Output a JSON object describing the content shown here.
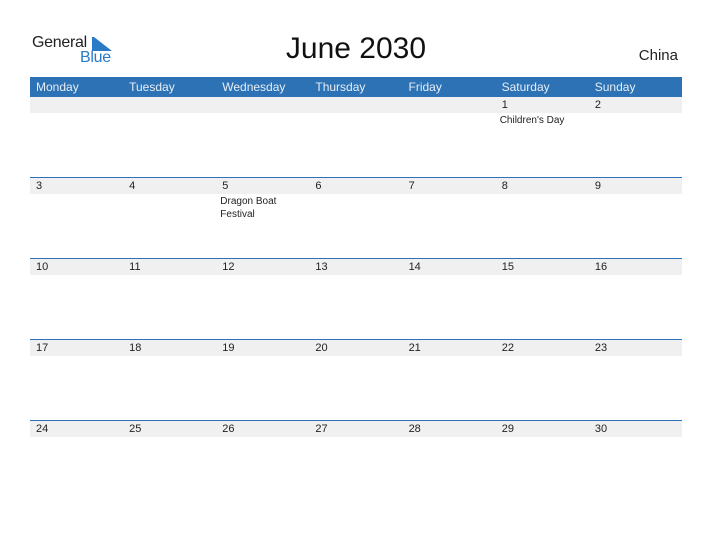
{
  "logo": {
    "general": "General",
    "blue": "Blue"
  },
  "title": "June 2030",
  "country": "China",
  "weekdays": [
    "Monday",
    "Tuesday",
    "Wednesday",
    "Thursday",
    "Friday",
    "Saturday",
    "Sunday"
  ],
  "weeks": [
    [
      {
        "day": "",
        "event": ""
      },
      {
        "day": "",
        "event": ""
      },
      {
        "day": "",
        "event": ""
      },
      {
        "day": "",
        "event": ""
      },
      {
        "day": "",
        "event": ""
      },
      {
        "day": "1",
        "event": "Children's Day"
      },
      {
        "day": "2",
        "event": ""
      }
    ],
    [
      {
        "day": "3",
        "event": ""
      },
      {
        "day": "4",
        "event": ""
      },
      {
        "day": "5",
        "event": "Dragon Boat Festival"
      },
      {
        "day": "6",
        "event": ""
      },
      {
        "day": "7",
        "event": ""
      },
      {
        "day": "8",
        "event": ""
      },
      {
        "day": "9",
        "event": ""
      }
    ],
    [
      {
        "day": "10",
        "event": ""
      },
      {
        "day": "11",
        "event": ""
      },
      {
        "day": "12",
        "event": ""
      },
      {
        "day": "13",
        "event": ""
      },
      {
        "day": "14",
        "event": ""
      },
      {
        "day": "15",
        "event": ""
      },
      {
        "day": "16",
        "event": ""
      }
    ],
    [
      {
        "day": "17",
        "event": ""
      },
      {
        "day": "18",
        "event": ""
      },
      {
        "day": "19",
        "event": ""
      },
      {
        "day": "20",
        "event": ""
      },
      {
        "day": "21",
        "event": ""
      },
      {
        "day": "22",
        "event": ""
      },
      {
        "day": "23",
        "event": ""
      }
    ],
    [
      {
        "day": "24",
        "event": ""
      },
      {
        "day": "25",
        "event": ""
      },
      {
        "day": "26",
        "event": ""
      },
      {
        "day": "27",
        "event": ""
      },
      {
        "day": "28",
        "event": ""
      },
      {
        "day": "29",
        "event": ""
      },
      {
        "day": "30",
        "event": ""
      }
    ]
  ],
  "colors": {
    "header": "#2d72b4",
    "strip": "#f0f0f0",
    "brand_blue": "#2a7ac7"
  }
}
